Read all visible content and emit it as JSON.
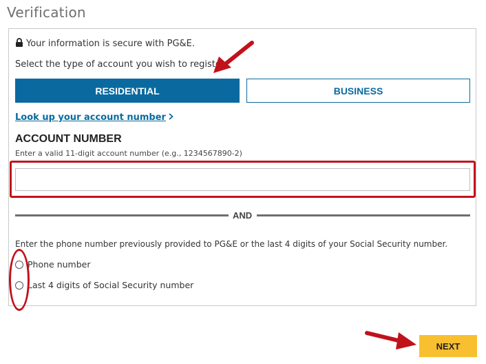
{
  "page": {
    "title": "Verification"
  },
  "form": {
    "secure_text": "Your information is secure with PG&E.",
    "select_prompt": "Select the type of account you wish to register.",
    "account_types": {
      "residential": "RESIDENTIAL",
      "business": "BUSINESS",
      "selected": "RESIDENTIAL"
    },
    "lookup_link": "Look up your account number",
    "account_number": {
      "label": "ACCOUNT NUMBER",
      "hint": "Enter a valid 11-digit account number (e.g., 1234567890-2)",
      "value": ""
    },
    "divider_label": "AND",
    "verify_prompt": "Enter the phone number previously provided to PG&E or the last 4 digits of your Social Security number.",
    "options": [
      {
        "label": "Phone number",
        "selected": false
      },
      {
        "label": "Last 4 digits of Social Security number",
        "selected": false
      }
    ]
  },
  "actions": {
    "next_label": "NEXT"
  },
  "colors": {
    "primary_blue": "#0a6a9f",
    "next_yellow": "#f8c031",
    "annotation_red": "#c1121c",
    "divider_gray": "#6e6e6e"
  }
}
